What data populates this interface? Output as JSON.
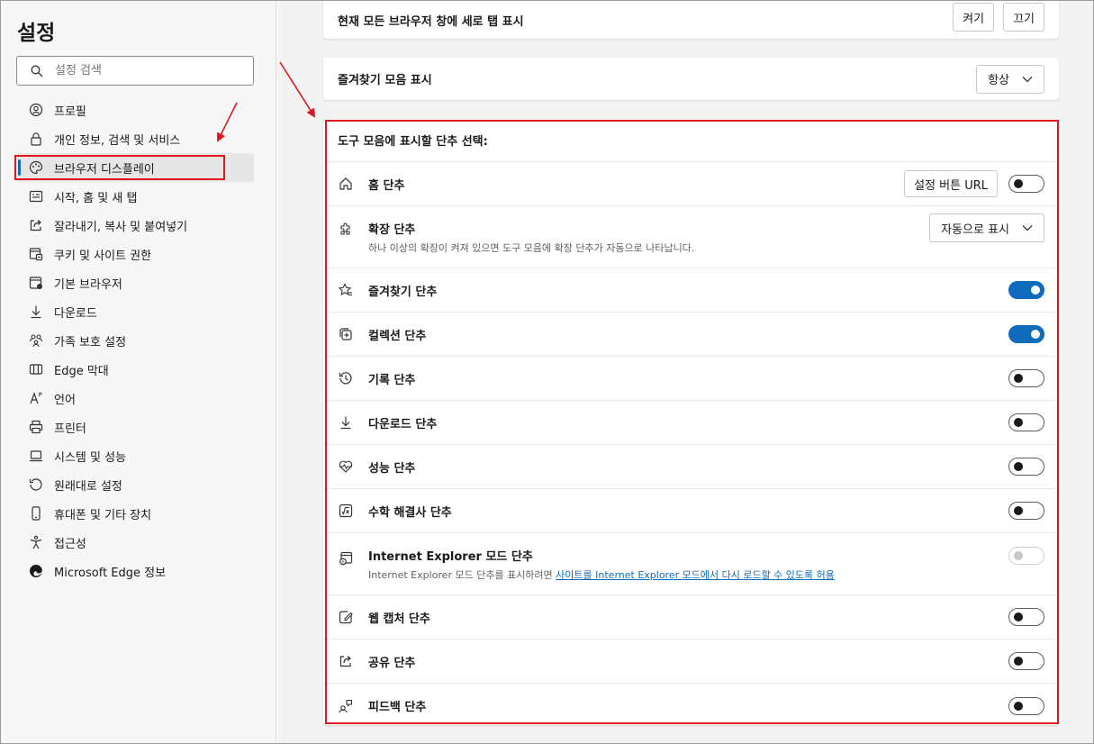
{
  "sidebar": {
    "title": "설정",
    "search_placeholder": "설정 검색",
    "items": [
      {
        "label": "프로필",
        "icon": "profile-icon"
      },
      {
        "label": "개인 정보, 검색 및 서비스",
        "icon": "lock-icon"
      },
      {
        "label": "브라우저 디스플레이",
        "icon": "palette-icon",
        "active": true
      },
      {
        "label": "시작, 홈 및 새 탭",
        "icon": "new-tab-icon"
      },
      {
        "label": "잘라내기, 복사 및 붙여넣기",
        "icon": "share-icon"
      },
      {
        "label": "쿠키 및 사이트 권한",
        "icon": "cookie-icon"
      },
      {
        "label": "기본 브라우저",
        "icon": "browser-icon"
      },
      {
        "label": "다운로드",
        "icon": "download-icon"
      },
      {
        "label": "가족 보호 설정",
        "icon": "family-icon"
      },
      {
        "label": "Edge 막대",
        "icon": "edge-bar-icon"
      },
      {
        "label": "언어",
        "icon": "language-icon"
      },
      {
        "label": "프린터",
        "icon": "printer-icon"
      },
      {
        "label": "시스템 및 성능",
        "icon": "laptop-icon"
      },
      {
        "label": "원래대로 설정",
        "icon": "reset-icon"
      },
      {
        "label": "휴대폰 및 기타 장치",
        "icon": "phone-icon"
      },
      {
        "label": "접근성",
        "icon": "accessibility-icon"
      },
      {
        "label": "Microsoft Edge 정보",
        "icon": "edge-logo-icon"
      }
    ]
  },
  "main": {
    "vertical_tabs": {
      "label": "현재 모든 브라우저 창에 세로 탭 표시",
      "on_label": "켜기",
      "off_label": "끄기"
    },
    "favorites_bar": {
      "label": "즐겨찾기 모음 표시",
      "value": "항상"
    },
    "toolbar": {
      "title": "도구 모음에 표시할 단추 선택:",
      "rows": [
        {
          "label": "홈 단추",
          "icon": "home-icon",
          "button": "설정 버튼 URL",
          "toggle": "off"
        },
        {
          "label": "확장 단추",
          "icon": "extension-icon",
          "desc": "하나 이상의 확장이 켜져 있으면 도구 모음에 확장 단추가 자동으로 나타납니다.",
          "dropdown": "자동으로 표시"
        },
        {
          "label": "즐겨찾기 단추",
          "icon": "favorites-icon",
          "toggle": "on"
        },
        {
          "label": "컬렉션 단추",
          "icon": "collections-icon",
          "toggle": "on"
        },
        {
          "label": "기록 단추",
          "icon": "history-icon",
          "toggle": "off"
        },
        {
          "label": "다운로드 단추",
          "icon": "download-icon",
          "toggle": "off"
        },
        {
          "label": "성능 단추",
          "icon": "performance-icon",
          "toggle": "off"
        },
        {
          "label": "수학 해결사 단추",
          "icon": "math-solver-icon",
          "toggle": "off"
        },
        {
          "label": "Internet Explorer 모드 단추",
          "icon": "ie-mode-icon",
          "desc": "Internet Explorer 모드 단추를 표시하려면",
          "link": "사이트를 Internet Explorer 모드에서 다시 로드할 수 있도록 허용",
          "toggle": "disabled"
        },
        {
          "label": "웹 캡처 단추",
          "icon": "web-capture-icon",
          "toggle": "off"
        },
        {
          "label": "공유 단추",
          "icon": "share-icon",
          "toggle": "off"
        },
        {
          "label": "피드백 단추",
          "icon": "feedback-icon",
          "toggle": "off"
        }
      ]
    }
  },
  "colors": {
    "accent": "#0f6cbd",
    "annotation": "#e0161e"
  }
}
